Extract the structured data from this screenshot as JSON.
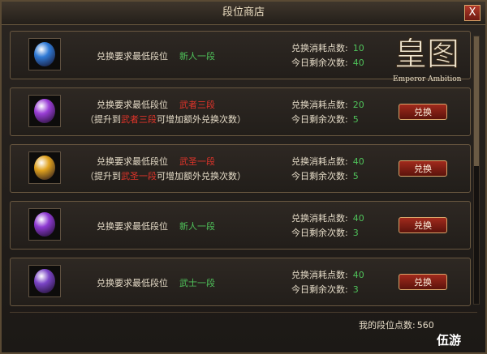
{
  "window": {
    "title": "段位商店",
    "close_label": "X"
  },
  "logo": {
    "mark": "皇图",
    "subtitle": "Emperor Ambition"
  },
  "labels": {
    "requirement": "兑换要求最低段位",
    "cost": "兑换消耗点数:",
    "remaining": "今日剩余次数:",
    "exchange_button": "兑换"
  },
  "items": [
    {
      "gem_color": "#2f7ad6",
      "icon": "blue-gem-icon",
      "rank": "新人一段",
      "rank_color": "green",
      "cost": "10",
      "remaining": "40",
      "has_button": false,
      "extra": null
    },
    {
      "gem_color": "#9a3ed6",
      "icon": "purple-gem-icon",
      "rank": "武者三段",
      "rank_color": "red",
      "cost": "20",
      "remaining": "5",
      "has_button": true,
      "extra": {
        "prefix": "（提升到",
        "rank": "武者三段",
        "suffix": "可增加额外兑换次数）"
      }
    },
    {
      "gem_color": "#e0a21e",
      "icon": "gold-gem-icon",
      "rank": "武圣一段",
      "rank_color": "red",
      "cost": "40",
      "remaining": "5",
      "has_button": true,
      "extra": {
        "prefix": "（提升到",
        "rank": "武圣一段",
        "suffix": "可增加额外兑换次数）"
      }
    },
    {
      "gem_color": "#8e3ad2",
      "icon": "violet-orb-icon",
      "rank": "新人一段",
      "rank_color": "green",
      "cost": "40",
      "remaining": "3",
      "has_button": true,
      "extra": null
    },
    {
      "gem_color": "#7a44c6",
      "icon": "feather-gem-icon",
      "rank": "武士一段",
      "rank_color": "green",
      "cost": "40",
      "remaining": "3",
      "has_button": true,
      "extra": null
    }
  ],
  "footer": {
    "label": "我的段位点数:",
    "value": "560"
  },
  "watermark": "伍游"
}
